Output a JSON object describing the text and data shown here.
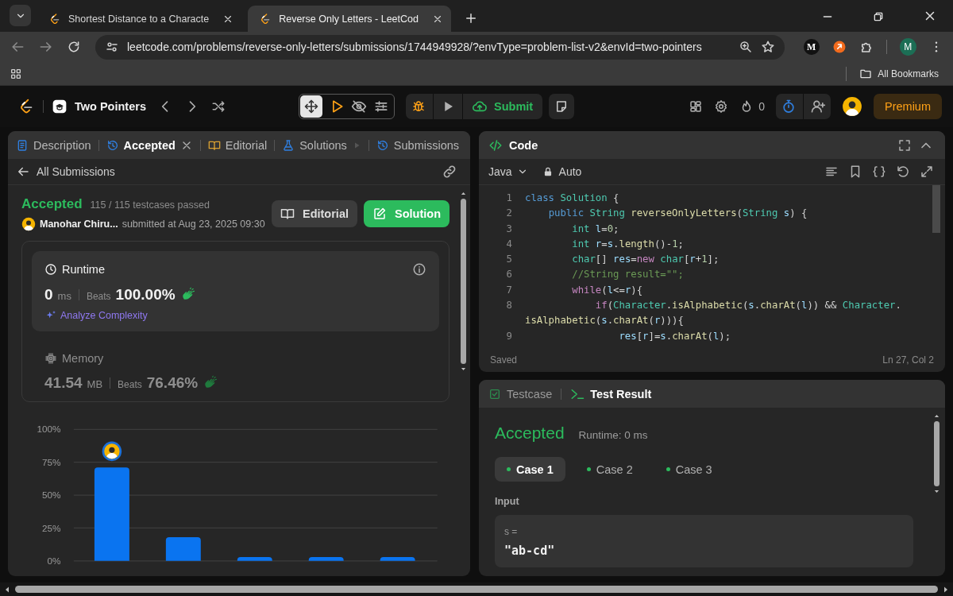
{
  "browser": {
    "tabs": [
      {
        "title": "Shortest Distance to a Characte",
        "selected": false
      },
      {
        "title": "Reverse Only Letters - LeetCod",
        "selected": true
      }
    ],
    "url": "leetcode.com/problems/reverse-only-letters/submissions/1744949928/?envType=problem-list-v2&envId=two-pointers",
    "extension_letter": "M",
    "profile_initial": "M",
    "bookmarks_label": "All Bookmarks"
  },
  "header": {
    "problem_list": "Two Pointers",
    "submit_label": "Submit",
    "streak": "0",
    "premium_label": "Premium"
  },
  "left_panel": {
    "tabs": [
      {
        "label": "Description",
        "closable": false,
        "selected": false
      },
      {
        "label": "Accepted",
        "closable": true,
        "selected": true
      },
      {
        "label": "Editorial",
        "closable": false,
        "selected": false
      },
      {
        "label": "Solutions",
        "closable": false,
        "selected": false
      },
      {
        "label": "Submissions",
        "closable": false,
        "selected": false
      }
    ],
    "back_label": "All Submissions",
    "status": "Accepted",
    "testcases": "115 / 115 testcases passed",
    "user": "Manohar Chiru...",
    "submitted": "submitted at Aug 23, 2025 09:30",
    "buttons": [
      {
        "label": "Editorial",
        "kind": "secondary"
      },
      {
        "label": "Solution",
        "kind": "primary"
      }
    ],
    "metrics": [
      {
        "title": "Runtime",
        "value": "0",
        "unit": "ms",
        "beats_label": "Beats",
        "beats": "100.00%",
        "link": "Analyze Complexity",
        "selected": true
      },
      {
        "title": "Memory",
        "value": "41.54",
        "unit": "MB",
        "beats_label": "Beats",
        "beats": "76.46%",
        "selected": false
      }
    ],
    "chart_data": {
      "type": "bar",
      "values": [
        71,
        18,
        3,
        3,
        3
      ],
      "ylim": [
        0,
        100
      ],
      "grid": true,
      "yticks": [
        {
          "value": 0,
          "label": "0%"
        },
        {
          "value": 25,
          "label": "25%"
        },
        {
          "value": 50,
          "label": "50%"
        },
        {
          "value": 75,
          "label": "75%"
        },
        {
          "value": 100,
          "label": "100%"
        }
      ]
    }
  },
  "code_panel": {
    "title": "Code",
    "language": "Java",
    "mode": "Auto",
    "lines": [
      {
        "number": "1",
        "tokens": [
          {
            "kind": "keyword",
            "text": "class"
          },
          {
            "kind": "type",
            "text": " Solution"
          },
          {
            "kind": "punct",
            "text": " {"
          }
        ]
      },
      {
        "number": "2",
        "tokens": [
          {
            "kind": "keyword",
            "text": "    public"
          },
          {
            "kind": "type",
            "text": " String"
          },
          {
            "kind": "function",
            "text": " reverseOnlyLetters"
          },
          {
            "kind": "punct",
            "text": "("
          },
          {
            "kind": "type",
            "text": "String"
          },
          {
            "kind": "variable",
            "text": " s"
          },
          {
            "kind": "punct",
            "text": ") {"
          }
        ]
      },
      {
        "number": "3",
        "tokens": [
          {
            "kind": "type",
            "text": "        int"
          },
          {
            "kind": "variable",
            "text": " l"
          },
          {
            "kind": "punct",
            "text": "="
          },
          {
            "kind": "number",
            "text": "0"
          },
          {
            "kind": "punct",
            "text": ";"
          }
        ]
      },
      {
        "number": "4",
        "tokens": [
          {
            "kind": "type",
            "text": "        int"
          },
          {
            "kind": "variable",
            "text": " r"
          },
          {
            "kind": "punct",
            "text": "="
          },
          {
            "kind": "variable",
            "text": "s"
          },
          {
            "kind": "punct",
            "text": "."
          },
          {
            "kind": "function",
            "text": "length"
          },
          {
            "kind": "punct",
            "text": "()-"
          },
          {
            "kind": "number",
            "text": "1"
          },
          {
            "kind": "punct",
            "text": ";"
          }
        ]
      },
      {
        "number": "5",
        "tokens": [
          {
            "kind": "type",
            "text": "        char"
          },
          {
            "kind": "punct",
            "text": "[]"
          },
          {
            "kind": "variable",
            "text": " res"
          },
          {
            "kind": "punct",
            "text": "="
          },
          {
            "kind": "control",
            "text": "new"
          },
          {
            "kind": "type",
            "text": " char"
          },
          {
            "kind": "punct",
            "text": "["
          },
          {
            "kind": "variable",
            "text": "r"
          },
          {
            "kind": "punct",
            "text": "+"
          },
          {
            "kind": "number",
            "text": "1"
          },
          {
            "kind": "punct",
            "text": "];"
          }
        ]
      },
      {
        "number": "6",
        "tokens": [
          {
            "kind": "comment",
            "text": "        //String result=\"\";"
          }
        ]
      },
      {
        "number": "7",
        "tokens": [
          {
            "kind": "control",
            "text": "        while"
          },
          {
            "kind": "punct",
            "text": "("
          },
          {
            "kind": "variable",
            "text": "l"
          },
          {
            "kind": "punct",
            "text": "<="
          },
          {
            "kind": "variable",
            "text": "r"
          },
          {
            "kind": "punct",
            "text": "){"
          }
        ]
      },
      {
        "number": "8",
        "tokens": [
          {
            "kind": "control",
            "text": "            if"
          },
          {
            "kind": "punct",
            "text": "("
          },
          {
            "kind": "type",
            "text": "Character"
          },
          {
            "kind": "punct",
            "text": "."
          },
          {
            "kind": "function",
            "text": "isAlphabetic"
          },
          {
            "kind": "punct",
            "text": "("
          },
          {
            "kind": "variable",
            "text": "s"
          },
          {
            "kind": "punct",
            "text": "."
          },
          {
            "kind": "function",
            "text": "charAt"
          },
          {
            "kind": "punct",
            "text": "("
          },
          {
            "kind": "variable",
            "text": "l"
          },
          {
            "kind": "punct",
            "text": ")) && "
          },
          {
            "kind": "type",
            "text": "Character"
          },
          {
            "kind": "punct",
            "text": "."
          },
          {
            "kind": "function",
            "text": "isAlphabetic"
          },
          {
            "kind": "punct",
            "text": "("
          },
          {
            "kind": "variable",
            "text": "s"
          },
          {
            "kind": "punct",
            "text": "."
          },
          {
            "kind": "function",
            "text": "charAt"
          },
          {
            "kind": "punct",
            "text": "("
          },
          {
            "kind": "variable",
            "text": "r"
          },
          {
            "kind": "punct",
            "text": "))){"
          }
        ]
      },
      {
        "number": "9",
        "tokens": [
          {
            "kind": "variable",
            "text": "                res"
          },
          {
            "kind": "punct",
            "text": "["
          },
          {
            "kind": "variable",
            "text": "r"
          },
          {
            "kind": "punct",
            "text": "]="
          },
          {
            "kind": "variable",
            "text": "s"
          },
          {
            "kind": "punct",
            "text": "."
          },
          {
            "kind": "function",
            "text": "charAt"
          },
          {
            "kind": "punct",
            "text": "("
          },
          {
            "kind": "variable",
            "text": "l"
          },
          {
            "kind": "punct",
            "text": ");"
          }
        ]
      }
    ],
    "status": "Saved",
    "cursor": "Ln 27, Col 2"
  },
  "result_panel": {
    "tabs": [
      {
        "label": "Testcase",
        "selected": false
      },
      {
        "label": "Test Result",
        "selected": true
      }
    ],
    "status": "Accepted",
    "runtime": "Runtime: 0 ms",
    "cases": [
      {
        "label": "Case 1",
        "passed": true,
        "selected": true
      },
      {
        "label": "Case 2",
        "passed": true,
        "selected": false
      },
      {
        "label": "Case 3",
        "passed": true,
        "selected": false
      }
    ],
    "input_label": "Input",
    "inputs": [
      {
        "name": "s =",
        "value": "\"ab-cd\""
      }
    ]
  }
}
